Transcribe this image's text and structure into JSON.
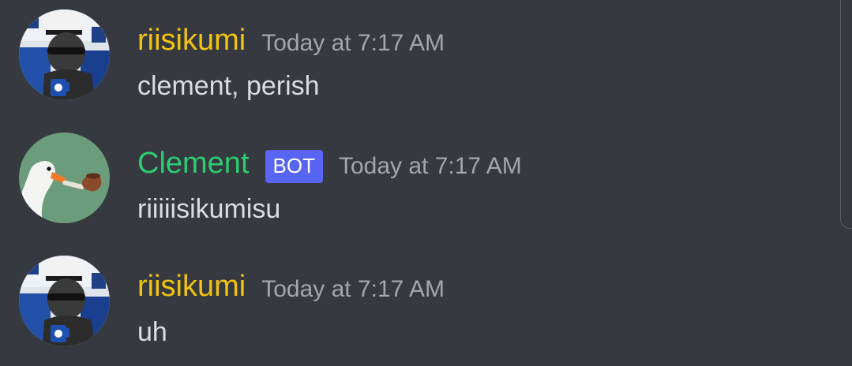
{
  "messages": [
    {
      "author": "riisikumi",
      "author_color": "#f1c40f",
      "is_bot": false,
      "timestamp": "Today at 7:17 AM",
      "content": "clement, perish",
      "avatar_icon": "user-avatar"
    },
    {
      "author": "Clement",
      "author_color": "#2ecc71",
      "is_bot": true,
      "bot_label": "BOT",
      "timestamp": "Today at 7:17 AM",
      "content": "riiiiisikumisu",
      "avatar_icon": "goose-with-pipe-avatar"
    },
    {
      "author": "riisikumi",
      "author_color": "#f1c40f",
      "is_bot": false,
      "timestamp": "Today at 7:17 AM",
      "content": "uh",
      "avatar_icon": "user-avatar"
    }
  ],
  "colors": {
    "background": "#36393f",
    "timestamp": "#a3a6aa",
    "message_text": "#dcddde",
    "bot_tag": "#5865f2"
  }
}
